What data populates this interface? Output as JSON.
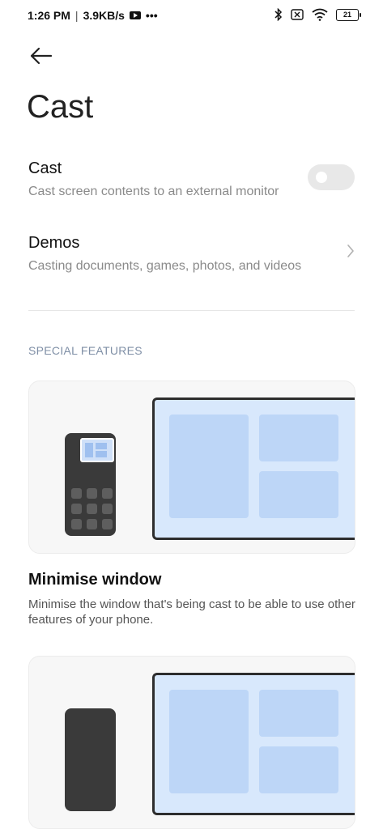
{
  "status_bar": {
    "time": "1:26 PM",
    "separator": "|",
    "net_speed": "3.9KB/s",
    "more": "•••",
    "battery": "21"
  },
  "header": {
    "title": "Cast"
  },
  "settings": {
    "cast": {
      "title": "Cast",
      "subtitle": "Cast screen contents to an external monitor",
      "enabled": false
    },
    "demos": {
      "title": "Demos",
      "subtitle": "Casting documents, games, photos, and videos"
    }
  },
  "special_features": {
    "header": "SPECIAL FEATURES",
    "items": [
      {
        "title": "Minimise window",
        "description": "Minimise the window that's being cast to be able to use other features of your phone."
      }
    ]
  },
  "colors": {
    "section_header": "#7f8fa6",
    "monitor_screen": "#d8e8fc",
    "tile": "#bdd6f7",
    "phone_body": "#3a3a3a"
  }
}
